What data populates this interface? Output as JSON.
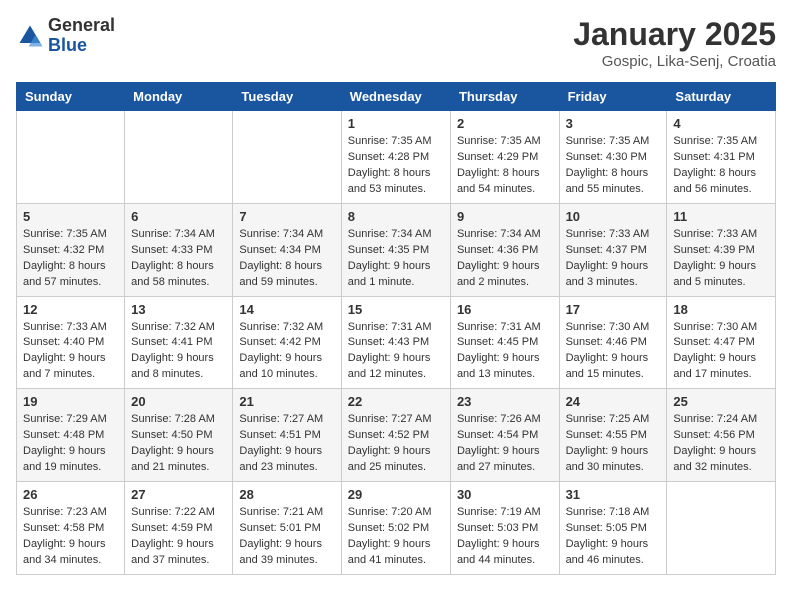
{
  "header": {
    "logo_general": "General",
    "logo_blue": "Blue",
    "month_year": "January 2025",
    "location": "Gospic, Lika-Senj, Croatia"
  },
  "days_of_week": [
    "Sunday",
    "Monday",
    "Tuesday",
    "Wednesday",
    "Thursday",
    "Friday",
    "Saturday"
  ],
  "weeks": [
    [
      {
        "day": "",
        "info": ""
      },
      {
        "day": "",
        "info": ""
      },
      {
        "day": "",
        "info": ""
      },
      {
        "day": "1",
        "info": "Sunrise: 7:35 AM\nSunset: 4:28 PM\nDaylight: 8 hours and 53 minutes."
      },
      {
        "day": "2",
        "info": "Sunrise: 7:35 AM\nSunset: 4:29 PM\nDaylight: 8 hours and 54 minutes."
      },
      {
        "day": "3",
        "info": "Sunrise: 7:35 AM\nSunset: 4:30 PM\nDaylight: 8 hours and 55 minutes."
      },
      {
        "day": "4",
        "info": "Sunrise: 7:35 AM\nSunset: 4:31 PM\nDaylight: 8 hours and 56 minutes."
      }
    ],
    [
      {
        "day": "5",
        "info": "Sunrise: 7:35 AM\nSunset: 4:32 PM\nDaylight: 8 hours and 57 minutes."
      },
      {
        "day": "6",
        "info": "Sunrise: 7:34 AM\nSunset: 4:33 PM\nDaylight: 8 hours and 58 minutes."
      },
      {
        "day": "7",
        "info": "Sunrise: 7:34 AM\nSunset: 4:34 PM\nDaylight: 8 hours and 59 minutes."
      },
      {
        "day": "8",
        "info": "Sunrise: 7:34 AM\nSunset: 4:35 PM\nDaylight: 9 hours and 1 minute."
      },
      {
        "day": "9",
        "info": "Sunrise: 7:34 AM\nSunset: 4:36 PM\nDaylight: 9 hours and 2 minutes."
      },
      {
        "day": "10",
        "info": "Sunrise: 7:33 AM\nSunset: 4:37 PM\nDaylight: 9 hours and 3 minutes."
      },
      {
        "day": "11",
        "info": "Sunrise: 7:33 AM\nSunset: 4:39 PM\nDaylight: 9 hours and 5 minutes."
      }
    ],
    [
      {
        "day": "12",
        "info": "Sunrise: 7:33 AM\nSunset: 4:40 PM\nDaylight: 9 hours and 7 minutes."
      },
      {
        "day": "13",
        "info": "Sunrise: 7:32 AM\nSunset: 4:41 PM\nDaylight: 9 hours and 8 minutes."
      },
      {
        "day": "14",
        "info": "Sunrise: 7:32 AM\nSunset: 4:42 PM\nDaylight: 9 hours and 10 minutes."
      },
      {
        "day": "15",
        "info": "Sunrise: 7:31 AM\nSunset: 4:43 PM\nDaylight: 9 hours and 12 minutes."
      },
      {
        "day": "16",
        "info": "Sunrise: 7:31 AM\nSunset: 4:45 PM\nDaylight: 9 hours and 13 minutes."
      },
      {
        "day": "17",
        "info": "Sunrise: 7:30 AM\nSunset: 4:46 PM\nDaylight: 9 hours and 15 minutes."
      },
      {
        "day": "18",
        "info": "Sunrise: 7:30 AM\nSunset: 4:47 PM\nDaylight: 9 hours and 17 minutes."
      }
    ],
    [
      {
        "day": "19",
        "info": "Sunrise: 7:29 AM\nSunset: 4:48 PM\nDaylight: 9 hours and 19 minutes."
      },
      {
        "day": "20",
        "info": "Sunrise: 7:28 AM\nSunset: 4:50 PM\nDaylight: 9 hours and 21 minutes."
      },
      {
        "day": "21",
        "info": "Sunrise: 7:27 AM\nSunset: 4:51 PM\nDaylight: 9 hours and 23 minutes."
      },
      {
        "day": "22",
        "info": "Sunrise: 7:27 AM\nSunset: 4:52 PM\nDaylight: 9 hours and 25 minutes."
      },
      {
        "day": "23",
        "info": "Sunrise: 7:26 AM\nSunset: 4:54 PM\nDaylight: 9 hours and 27 minutes."
      },
      {
        "day": "24",
        "info": "Sunrise: 7:25 AM\nSunset: 4:55 PM\nDaylight: 9 hours and 30 minutes."
      },
      {
        "day": "25",
        "info": "Sunrise: 7:24 AM\nSunset: 4:56 PM\nDaylight: 9 hours and 32 minutes."
      }
    ],
    [
      {
        "day": "26",
        "info": "Sunrise: 7:23 AM\nSunset: 4:58 PM\nDaylight: 9 hours and 34 minutes."
      },
      {
        "day": "27",
        "info": "Sunrise: 7:22 AM\nSunset: 4:59 PM\nDaylight: 9 hours and 37 minutes."
      },
      {
        "day": "28",
        "info": "Sunrise: 7:21 AM\nSunset: 5:01 PM\nDaylight: 9 hours and 39 minutes."
      },
      {
        "day": "29",
        "info": "Sunrise: 7:20 AM\nSunset: 5:02 PM\nDaylight: 9 hours and 41 minutes."
      },
      {
        "day": "30",
        "info": "Sunrise: 7:19 AM\nSunset: 5:03 PM\nDaylight: 9 hours and 44 minutes."
      },
      {
        "day": "31",
        "info": "Sunrise: 7:18 AM\nSunset: 5:05 PM\nDaylight: 9 hours and 46 minutes."
      },
      {
        "day": "",
        "info": ""
      }
    ]
  ]
}
